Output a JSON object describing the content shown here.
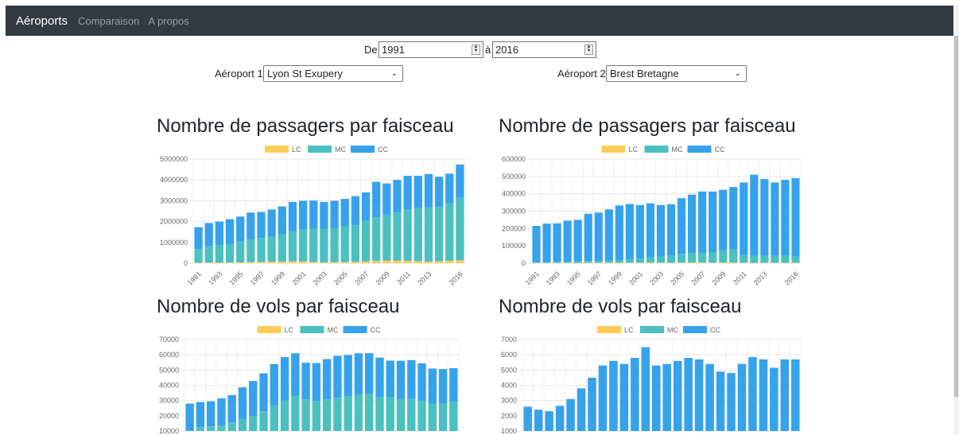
{
  "navbar": {
    "brand": "Aéroports",
    "links": [
      "Comparaison",
      "A propos"
    ]
  },
  "filters": {
    "from_label": "De",
    "from_value": "1991",
    "to_label": "à",
    "to_value": "2016",
    "airport1_label": "Aéroport 1",
    "airport1_value": "Lyon St Exupery",
    "airport2_label": "Aéroport 2",
    "airport2_value": "Brest Bretagne"
  },
  "colors": {
    "LC": "#ffcd56",
    "MC": "#4bc0c0",
    "CC": "#36a2eb",
    "grid": "#e6e6e6"
  },
  "charts": [
    {
      "title": "Nombre de passagers par faisceau"
    },
    {
      "title": "Nombre de passagers par faisceau"
    },
    {
      "title": "Nombre de vols par faisceau"
    },
    {
      "title": "Nombre de vols par faisceau"
    }
  ],
  "chart_data": [
    {
      "type": "bar",
      "title": "Nombre de passagers par faisceau",
      "stacked": true,
      "categories": [
        "1991",
        "1992",
        "1993",
        "1994",
        "1995",
        "1996",
        "1997",
        "1998",
        "1999",
        "2000",
        "2001",
        "2002",
        "2003",
        "2004",
        "2005",
        "2006",
        "2007",
        "2008",
        "2009",
        "2010",
        "2011",
        "2012",
        "2013",
        "2014",
        "2015",
        "2016"
      ],
      "x_tick_labels": [
        "1991",
        "1993",
        "1995",
        "1997",
        "1999",
        "2001",
        "2003",
        "2005",
        "2007",
        "2009",
        "2011",
        "2013",
        "2016"
      ],
      "ylim": [
        0,
        5000000
      ],
      "y_ticks": [
        0,
        1000000,
        2000000,
        3000000,
        4000000,
        5000000
      ],
      "legend": [
        "LC",
        "MC",
        "CC"
      ],
      "legend_position": "top",
      "series": [
        {
          "name": "LC",
          "values": [
            30000,
            30000,
            30000,
            35000,
            40000,
            50000,
            60000,
            80000,
            80000,
            90000,
            90000,
            60000,
            40000,
            50000,
            60000,
            70000,
            90000,
            110000,
            130000,
            130000,
            120000,
            100000,
            80000,
            100000,
            120000,
            140000
          ]
        },
        {
          "name": "MC",
          "values": [
            650000,
            800000,
            850000,
            900000,
            1000000,
            1100000,
            1150000,
            1200000,
            1300000,
            1450000,
            1550000,
            1600000,
            1600000,
            1650000,
            1700000,
            1750000,
            1950000,
            2100000,
            2200000,
            2300000,
            2450000,
            2550000,
            2600000,
            2600000,
            2750000,
            3000000
          ]
        },
        {
          "name": "CC",
          "values": [
            1050000,
            1100000,
            1120000,
            1180000,
            1200000,
            1280000,
            1250000,
            1300000,
            1350000,
            1400000,
            1360000,
            1350000,
            1300000,
            1300000,
            1330000,
            1400000,
            1360000,
            1700000,
            1500000,
            1570000,
            1630000,
            1550000,
            1600000,
            1450000,
            1430000,
            1600000
          ]
        }
      ]
    },
    {
      "type": "bar",
      "title": "Nombre de passagers par faisceau",
      "stacked": true,
      "categories": [
        "1991",
        "1992",
        "1993",
        "1994",
        "1995",
        "1996",
        "1997",
        "1998",
        "1999",
        "2000",
        "2001",
        "2002",
        "2003",
        "2004",
        "2005",
        "2006",
        "2007",
        "2008",
        "2009",
        "2010",
        "2011",
        "2012",
        "2013",
        "2014",
        "2015",
        "2016"
      ],
      "x_tick_labels": [
        "1991",
        "1993",
        "1995",
        "1997",
        "1999",
        "2001",
        "2003",
        "2005",
        "2007",
        "2009",
        "2011",
        "2013",
        "2016"
      ],
      "ylim": [
        0,
        600000
      ],
      "y_ticks": [
        0,
        100000,
        200000,
        300000,
        400000,
        500000,
        600000
      ],
      "legend": [
        "LC",
        "MC",
        "CC"
      ],
      "legend_position": "top",
      "series": [
        {
          "name": "LC",
          "values": [
            2000,
            2000,
            2000,
            2000,
            2000,
            3000,
            3000,
            3000,
            3000,
            3000,
            3000,
            3000,
            3000,
            3000,
            4000,
            4000,
            4000,
            4000,
            4000,
            4000,
            3000,
            3000,
            3000,
            3000,
            3000,
            3000
          ]
        },
        {
          "name": "MC",
          "values": [
            5000,
            5000,
            6000,
            6000,
            8000,
            10000,
            10000,
            12000,
            15000,
            20000,
            25000,
            30000,
            35000,
            40000,
            50000,
            55000,
            55000,
            60000,
            70000,
            75000,
            45000,
            40000,
            40000,
            40000,
            40000,
            35000
          ]
        },
        {
          "name": "CC",
          "values": [
            208000,
            221000,
            222000,
            237000,
            240000,
            272000,
            279000,
            295000,
            315000,
            318000,
            307000,
            312000,
            297000,
            297000,
            321000,
            336000,
            354000,
            349000,
            349000,
            360000,
            417000,
            467000,
            442000,
            422000,
            437000,
            452000
          ]
        }
      ]
    },
    {
      "type": "bar",
      "title": "Nombre de vols par faisceau",
      "stacked": true,
      "categories": [
        "1991",
        "1992",
        "1993",
        "1994",
        "1995",
        "1996",
        "1997",
        "1998",
        "1999",
        "2000",
        "2001",
        "2002",
        "2003",
        "2004",
        "2005",
        "2006",
        "2007",
        "2008",
        "2009",
        "2010",
        "2011",
        "2012",
        "2013",
        "2014",
        "2015",
        "2016"
      ],
      "ylim": [
        10000,
        70000
      ],
      "y_ticks": [
        10000,
        20000,
        30000,
        40000,
        50000,
        60000,
        70000
      ],
      "legend": [
        "LC",
        "MC",
        "CC"
      ],
      "legend_position": "top",
      "series": [
        {
          "name": "LC",
          "values": [
            500,
            500,
            500,
            500,
            600,
            700,
            800,
            900,
            900,
            1000,
            1000,
            800,
            600,
            700,
            800,
            900,
            1000,
            1100,
            1200,
            1200,
            1100,
            1000,
            900,
            1000,
            1100,
            1200
          ]
        },
        {
          "name": "MC",
          "values": [
            10000,
            12000,
            12500,
            13000,
            15000,
            17000,
            19000,
            22000,
            26000,
            29000,
            32000,
            30000,
            29000,
            30000,
            31000,
            32000,
            33000,
            33000,
            31000,
            31000,
            30000,
            30000,
            29000,
            27000,
            27000,
            28000
          ]
        },
        {
          "name": "CC",
          "values": [
            17500,
            16500,
            16500,
            18000,
            18000,
            21000,
            23000,
            25000,
            27000,
            28500,
            28000,
            24000,
            25000,
            26500,
            27500,
            27000,
            27000,
            27000,
            26000,
            24000,
            25000,
            25500,
            24500,
            23000,
            22500,
            22000
          ]
        }
      ]
    },
    {
      "type": "bar",
      "title": "Nombre de vols par faisceau",
      "stacked": true,
      "categories": [
        "1991",
        "1992",
        "1993",
        "1994",
        "1995",
        "1996",
        "1997",
        "1998",
        "1999",
        "2000",
        "2001",
        "2002",
        "2003",
        "2004",
        "2005",
        "2006",
        "2007",
        "2008",
        "2009",
        "2010",
        "2011",
        "2012",
        "2013",
        "2014",
        "2015",
        "2016"
      ],
      "ylim": [
        1000,
        7000
      ],
      "y_ticks": [
        1000,
        2000,
        3000,
        4000,
        5000,
        6000,
        7000
      ],
      "legend": [
        "LC",
        "MC",
        "CC"
      ],
      "legend_position": "top",
      "series": [
        {
          "name": "LC",
          "values": [
            0,
            0,
            0,
            0,
            0,
            0,
            0,
            0,
            0,
            0,
            0,
            0,
            0,
            0,
            0,
            0,
            0,
            0,
            0,
            0,
            0,
            0,
            0,
            0,
            0,
            0
          ]
        },
        {
          "name": "MC",
          "values": [
            0,
            0,
            0,
            0,
            0,
            0,
            0,
            0,
            0,
            0,
            0,
            0,
            0,
            0,
            0,
            0,
            0,
            0,
            0,
            0,
            0,
            0,
            0,
            0,
            0,
            0
          ]
        },
        {
          "name": "CC",
          "values": [
            2600,
            2400,
            2300,
            2650,
            3100,
            3800,
            4500,
            5300,
            5600,
            5400,
            5800,
            6500,
            5300,
            5400,
            5600,
            5800,
            5700,
            5400,
            4900,
            4800,
            5400,
            5850,
            5700,
            5150,
            5700,
            5700
          ]
        }
      ]
    }
  ]
}
